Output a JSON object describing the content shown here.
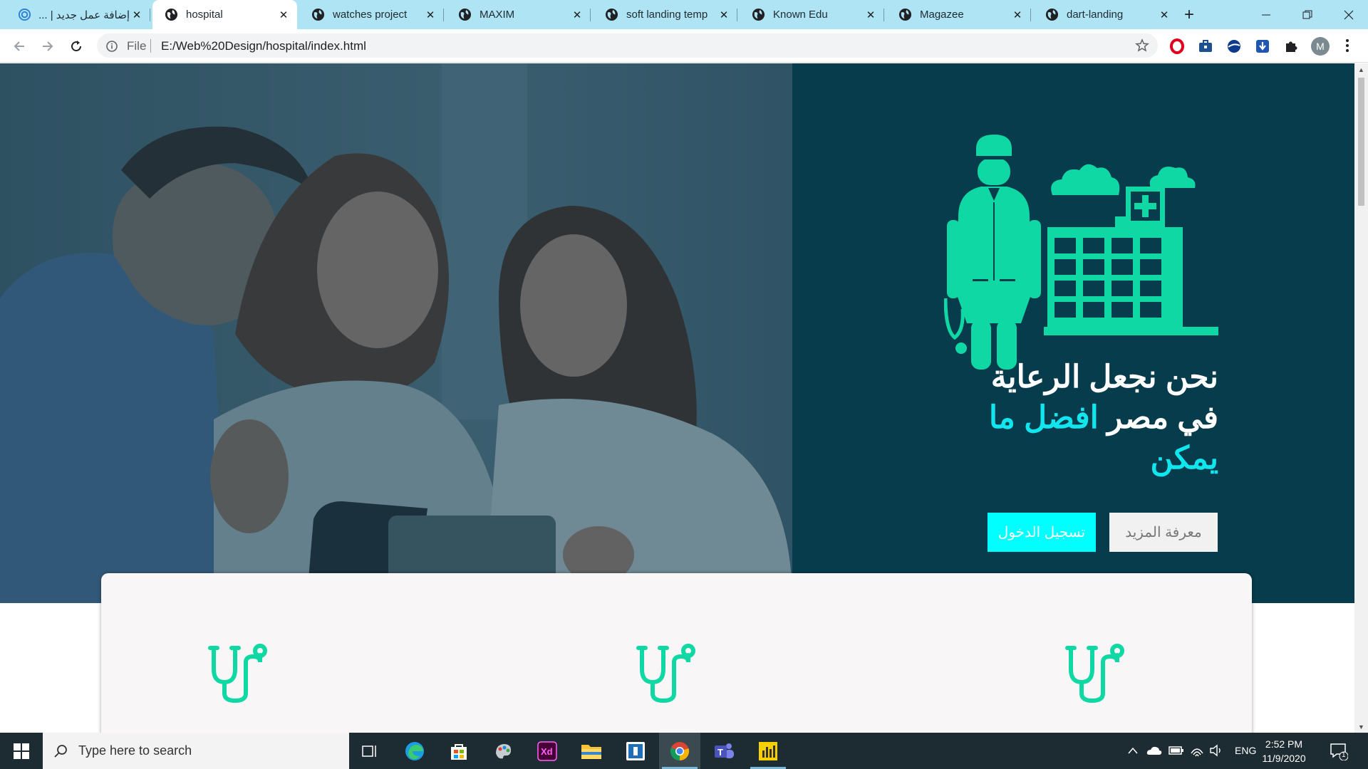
{
  "browser": {
    "tabs": [
      {
        "title": "إضافة عمل جديد | ...",
        "icon": "spiral-icon",
        "active": false
      },
      {
        "title": "hospital",
        "icon": "globe-icon",
        "active": true
      },
      {
        "title": "watches project",
        "icon": "globe-icon",
        "active": false
      },
      {
        "title": "MAXIM",
        "icon": "globe-icon",
        "active": false
      },
      {
        "title": "soft landing temp",
        "icon": "globe-icon",
        "active": false
      },
      {
        "title": "Known Edu",
        "icon": "globe-icon",
        "active": false
      },
      {
        "title": "Magazee",
        "icon": "globe-icon",
        "active": false
      },
      {
        "title": "dart-landing",
        "icon": "globe-icon",
        "active": false
      }
    ],
    "address": {
      "scheme_label": "File",
      "url": "E:/Web%20Design/hospital/index.html"
    },
    "profile_initial": "M",
    "extensions": [
      "opera-icon",
      "briefcase-icon",
      "globe-extension-icon",
      "download-icon",
      "puzzle-icon"
    ]
  },
  "page": {
    "hero": {
      "headline_line1": "نحن نجعل الرعاية",
      "headline_line2_plain": "في مصر",
      "headline_line2_accent": "افضل ما",
      "headline_line3_accent": "يمكن",
      "login_button": "تسجيل الدخول",
      "more_button": "معرفة المزيد",
      "colors": {
        "background": "#063c4c",
        "accent": "#11e5ee",
        "illustration": "#0fd8a4"
      }
    },
    "features": [
      {
        "icon": "stethoscope-icon"
      },
      {
        "icon": "stethoscope-icon"
      },
      {
        "icon": "stethoscope-icon"
      }
    ]
  },
  "taskbar": {
    "search_placeholder": "Type here to search",
    "language": "ENG",
    "time": "2:52 PM",
    "date": "11/9/2020",
    "notification_count": "1"
  }
}
